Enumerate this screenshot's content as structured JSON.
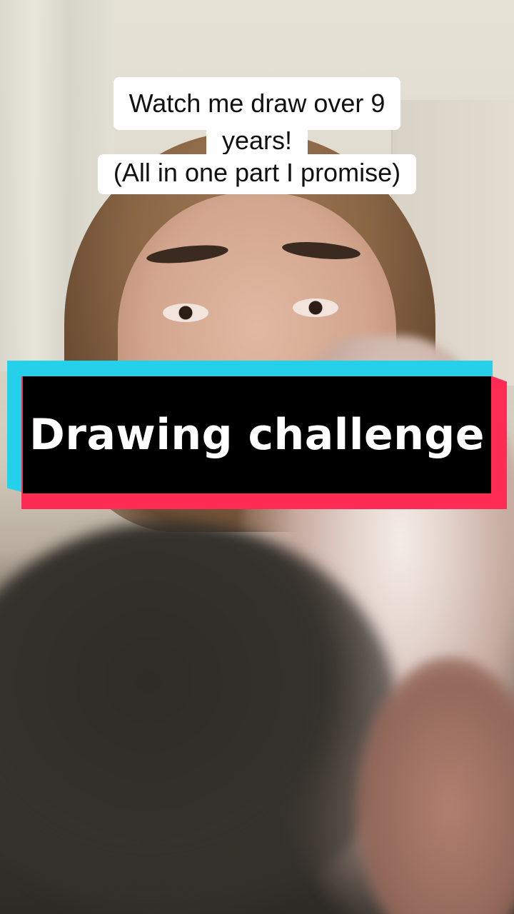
{
  "caption": {
    "line1": "Watch me draw over 9",
    "line2": "years!",
    "line3": "(All in one part I promise)"
  },
  "banner": {
    "text": "Drawing challenge",
    "colors": {
      "cyan": "#25d0ea",
      "pink": "#fe2c55",
      "background": "#000000",
      "text": "#ffffff"
    }
  }
}
